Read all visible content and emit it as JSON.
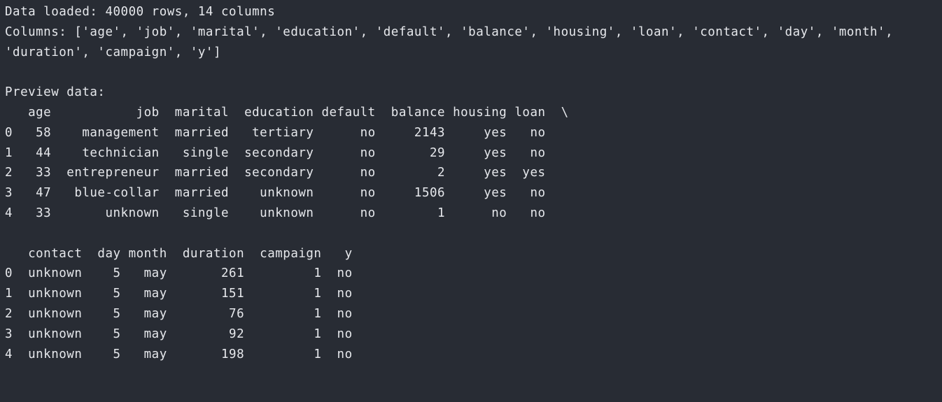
{
  "output": {
    "load_message": "Data loaded: 40000 rows, 14 columns",
    "columns_line_1": "Columns: ['age', 'job', 'marital', 'education', 'default', 'balance', 'housing', 'loan', 'contact', 'day', 'month',",
    "columns_line_2": "'duration', 'campaign', 'y']",
    "preview_label": "Preview data:",
    "table1": {
      "header": "   age           job  marital  education default  balance housing loan  \\",
      "rows": [
        "0   58    management  married   tertiary      no     2143     yes   no",
        "1   44    technician   single  secondary      no       29     yes   no",
        "2   33  entrepreneur  married  secondary      no        2     yes  yes",
        "3   47   blue-collar  married    unknown      no     1506     yes   no",
        "4   33       unknown   single    unknown      no        1      no   no"
      ]
    },
    "table2": {
      "header": "   contact  day month  duration  campaign   y",
      "rows": [
        "0  unknown    5   may       261         1  no",
        "1  unknown    5   may       151         1  no",
        "2  unknown    5   may        76         1  no",
        "3  unknown    5   may        92         1  no",
        "4  unknown    5   may       198         1  no"
      ]
    }
  }
}
